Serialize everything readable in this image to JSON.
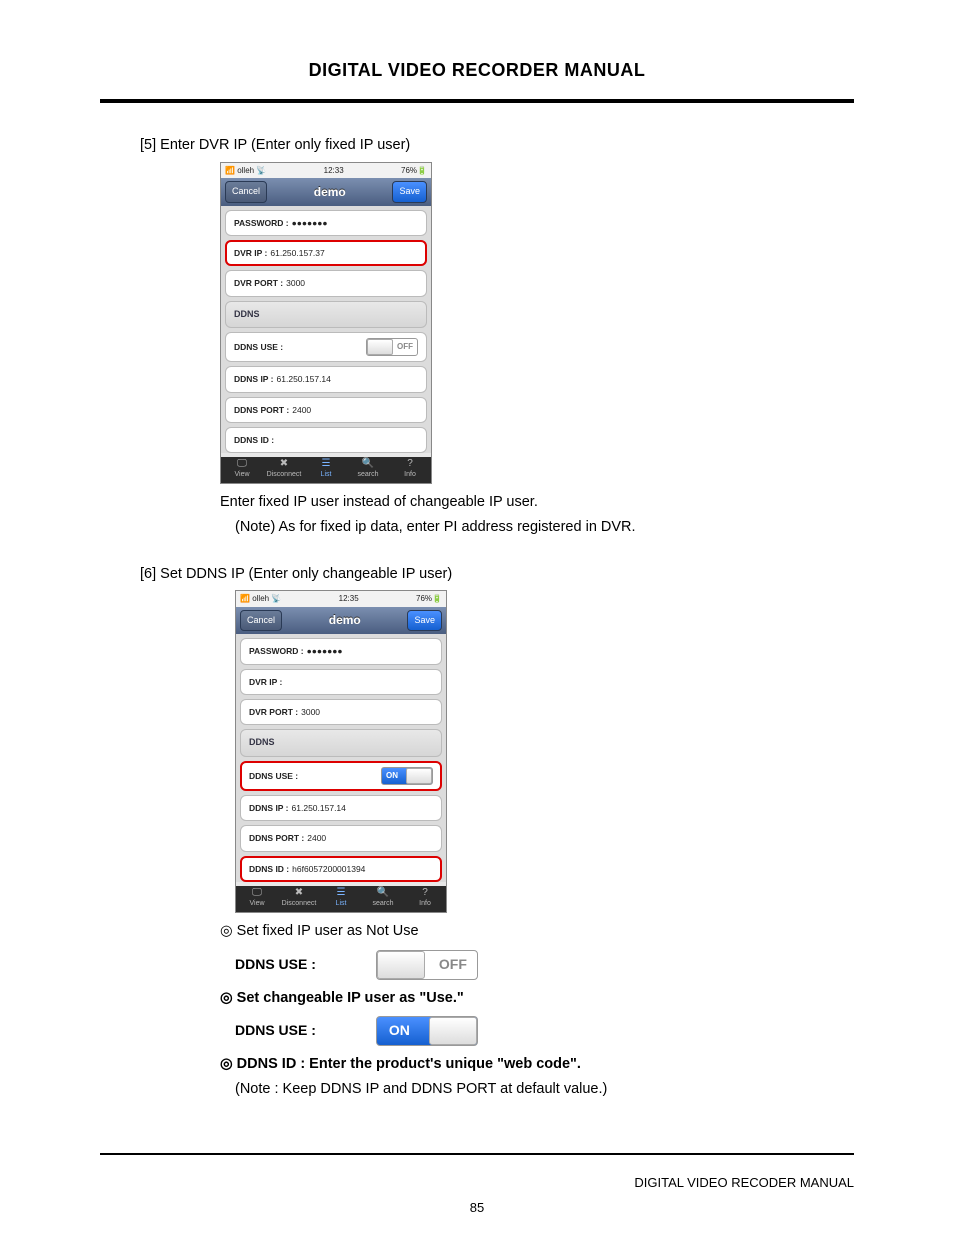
{
  "header": {
    "title": "DIGITAL VIDEO RECORDER MANUAL"
  },
  "step5": {
    "heading": "[5] Enter DVR IP (Enter only fixed IP user)",
    "line1": "Enter fixed IP user instead of changeable IP user.",
    "line2": "(Note) As for fixed ip data, enter PI address registered in DVR."
  },
  "step6": {
    "heading": "[6] Set DDNS IP (Enter only changeable IP user)",
    "bullet1": "◎ Set fixed IP user as Not Use",
    "ddns_label": "DDNS USE :",
    "off_text": "OFF",
    "bullet2": "◎ Set changeable IP user as \"Use.\"",
    "on_text": "ON",
    "bullet3": "◎ DDNS ID : Enter the product's unique \"web code\".",
    "note": "(Note : Keep DDNS IP and DDNS PORT at default value.)"
  },
  "screenshot1": {
    "carrier": "olleh",
    "time": "12:33",
    "battery": "76%",
    "cancel": "Cancel",
    "title": "demo",
    "save": "Save",
    "password_label": "PASSWORD :",
    "password_value": "●●●●●●●",
    "dvr_ip_label": "DVR IP :",
    "dvr_ip_value": "61.250.157.37",
    "dvr_port_label": "DVR PORT :",
    "dvr_port_value": "3000",
    "ddns_header": "DDNS",
    "ddns_use_label": "DDNS USE :",
    "ddns_use_state": "OFF",
    "ddns_ip_label": "DDNS IP :",
    "ddns_ip_value": "61.250.157.14",
    "ddns_port_label": "DDNS PORT :",
    "ddns_port_value": "2400",
    "ddns_id_label": "DDNS ID :",
    "ddns_id_value": "",
    "tabs": {
      "view": "View",
      "disconnect": "Disconnect",
      "list": "List",
      "search": "search",
      "info": "Info"
    }
  },
  "screenshot2": {
    "carrier": "olleh",
    "time": "12:35",
    "battery": "76%",
    "cancel": "Cancel",
    "title": "demo",
    "save": "Save",
    "password_label": "PASSWORD :",
    "password_value": "●●●●●●●",
    "dvr_ip_label": "DVR IP :",
    "dvr_ip_value": "",
    "dvr_port_label": "DVR PORT :",
    "dvr_port_value": "3000",
    "ddns_header": "DDNS",
    "ddns_use_label": "DDNS USE :",
    "ddns_use_state": "ON",
    "ddns_ip_label": "DDNS IP :",
    "ddns_ip_value": "61.250.157.14",
    "ddns_port_label": "DDNS PORT :",
    "ddns_port_value": "2400",
    "ddns_id_label": "DDNS ID :",
    "ddns_id_value": "h6f6057200001394",
    "tabs": {
      "view": "View",
      "disconnect": "Disconnect",
      "list": "List",
      "search": "search",
      "info": "Info"
    }
  },
  "footer": {
    "right": "DIGITAL VIDEO RECODER MANUAL",
    "page": "85"
  }
}
